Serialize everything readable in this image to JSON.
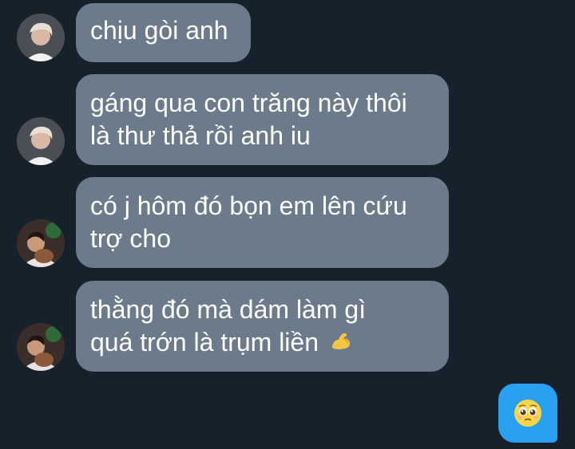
{
  "theme": {
    "background": "#17212b",
    "bubble_in": "#6b7b8b",
    "bubble_out": "#2aa0f0",
    "text": "#ffffff"
  },
  "messages": [
    {
      "lines": [
        "chịu gòi anh"
      ],
      "avatar": "user-blonde-avatar"
    },
    {
      "lines": [
        "gáng qua con trăng này thôi",
        "là thư thả rồi anh iu"
      ],
      "avatar": "user-blonde-avatar"
    },
    {
      "lines": [
        "có j hôm đó bọn em lên cứu",
        "trợ cho"
      ],
      "avatar": "user-dark-avatar"
    },
    {
      "lines": [
        "thằng đó mà dám làm gì",
        "quá trớn là trụm liền"
      ],
      "emoji": "flexed-biceps",
      "avatar": "user-dark-avatar"
    }
  ],
  "own_message": {
    "emoji": "pleading-face"
  }
}
